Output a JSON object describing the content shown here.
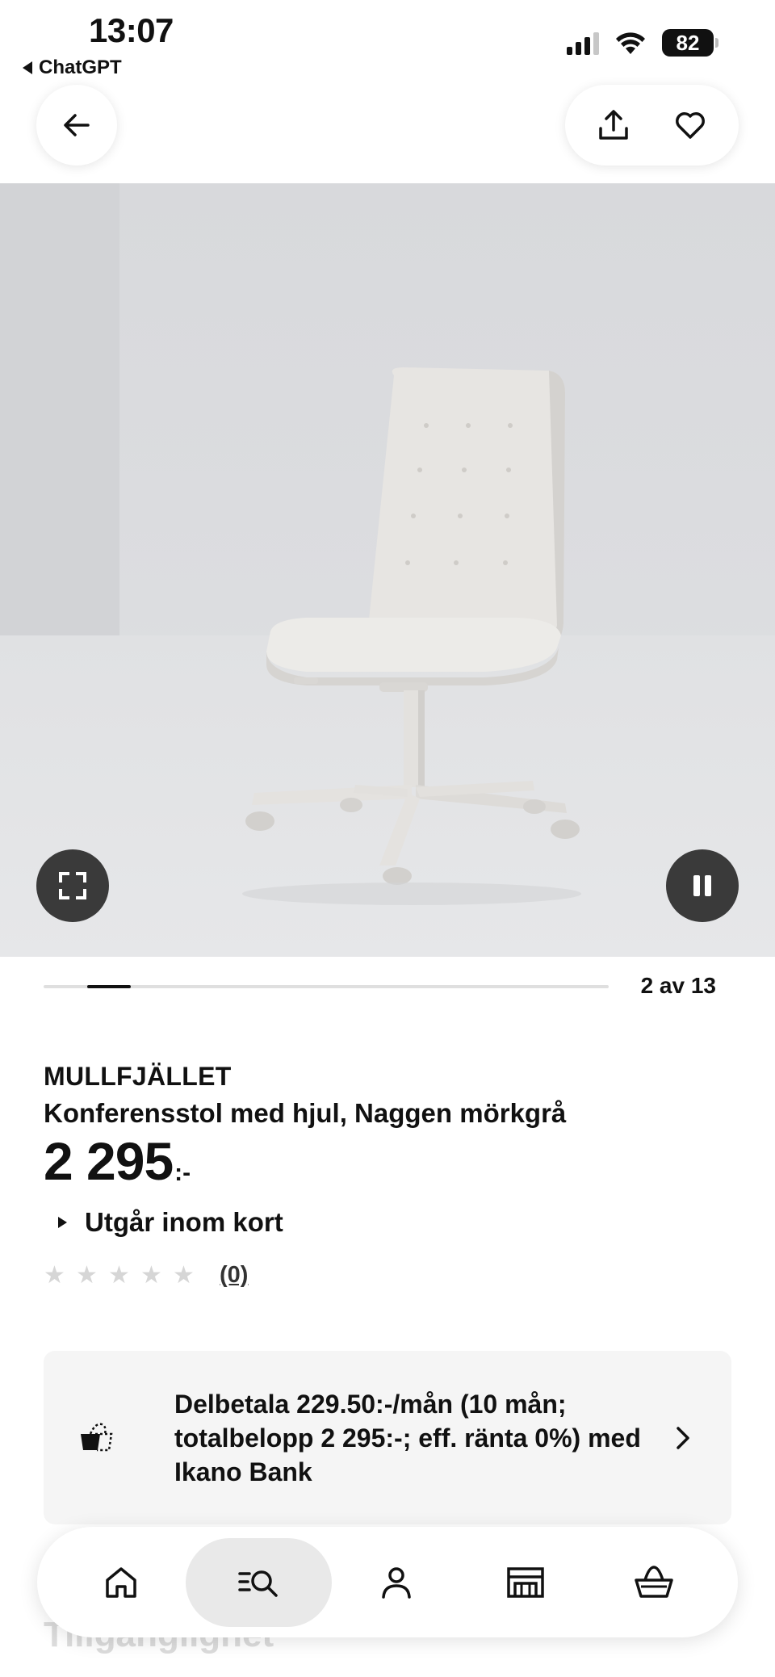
{
  "status_bar": {
    "time": "13:07",
    "back_app": "ChatGPT",
    "battery": "82"
  },
  "gallery": {
    "counter": "2 av 13",
    "current": 2,
    "total": 13
  },
  "product": {
    "name": "MULLFJÄLLET",
    "description": "Konferensstol med hjul, Naggen mörkgrå",
    "price": "2 295",
    "price_suffix": ":-",
    "availability": "Utgår inom kort",
    "rating_stars": 0,
    "rating_count": "(0)"
  },
  "payment": {
    "text": "Delbetala 229.50:-/mån (10 mån; totalbelopp 2 295:-; eff. ränta 0%) med Ikano Bank"
  },
  "next_section_title": "Tillgänglighet",
  "tabs": [
    {
      "icon": "home-icon",
      "active": false
    },
    {
      "icon": "search-list-icon",
      "active": true
    },
    {
      "icon": "profile-icon",
      "active": false
    },
    {
      "icon": "store-icon",
      "active": false
    },
    {
      "icon": "basket-icon",
      "active": false
    }
  ],
  "colors": {
    "text": "#111111",
    "hero_background": "#dcdde0",
    "card_background": "#f5f5f5",
    "control_dark": "#3a3a3a"
  }
}
